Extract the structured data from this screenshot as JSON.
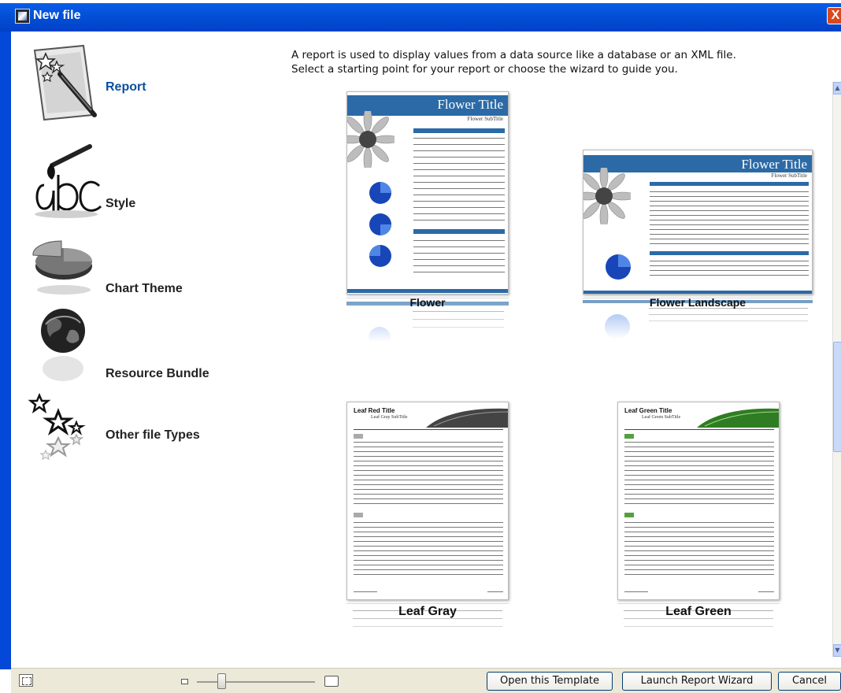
{
  "window": {
    "title": "New file",
    "close_glyph": "X"
  },
  "sidebar": {
    "items": [
      {
        "label": "Report",
        "icon": "report-icon",
        "selected": true
      },
      {
        "label": "Style",
        "icon": "style-icon",
        "selected": false
      },
      {
        "label": "Chart Theme",
        "icon": "chart-theme-icon",
        "selected": false
      },
      {
        "label": "Resource Bundle",
        "icon": "resource-bundle-icon",
        "selected": false
      },
      {
        "label": "Other file Types",
        "icon": "stars-icon",
        "selected": false
      }
    ]
  },
  "main": {
    "description_line1": "A report is used to display values from a data source like a database or an XML file.",
    "description_line2": "Select a starting point for your report or choose the wizard to guide you.",
    "templates": [
      {
        "label": "Flower",
        "title": "Flower Title",
        "subtitle": "Flower SubTitle",
        "accent": "#2b6aa6"
      },
      {
        "label": "Flower Landscape",
        "title": "Flower Title",
        "subtitle": "Flower SubTitle",
        "accent": "#2b6aa6"
      },
      {
        "label": "Leaf Gray",
        "title": "Leaf Red Title",
        "subtitle": "Leaf Gray SubTitle",
        "accent": "#666666"
      },
      {
        "label": "Leaf Green",
        "title": "Leaf Green Title",
        "subtitle": "Leaf Green SubTitle",
        "accent": "#54a040"
      }
    ]
  },
  "footer": {
    "open_template_label": "Open this Template",
    "launch_wizard_label": "Launch Report Wizard",
    "cancel_label": "Cancel",
    "zoom_level": 0.2
  },
  "colors": {
    "titlebar": "#0351d8",
    "selected_label": "#0a4f9e",
    "flower_blue": "#2b6aa6",
    "leaf_green": "#54a040"
  }
}
